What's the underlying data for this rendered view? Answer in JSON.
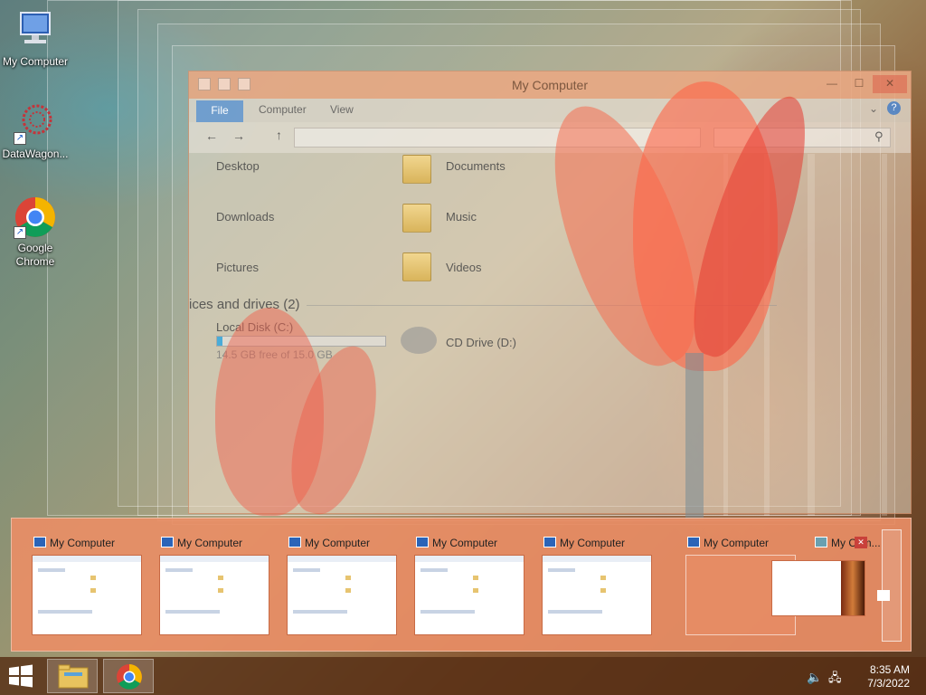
{
  "desktop": {
    "icons": [
      {
        "label": "My Computer"
      },
      {
        "label": "DataWagon..."
      },
      {
        "label": "Google Chrome"
      }
    ]
  },
  "explorer": {
    "title": "My Computer",
    "ribbon_tabs": [
      "File",
      "Computer",
      "View"
    ],
    "folders": [
      "Desktop",
      "Documents",
      "Downloads",
      "Music",
      "Pictures",
      "Videos"
    ],
    "devices_header": "ices and drives (2)",
    "drives": [
      {
        "name": "Local Disk (C:)",
        "free_text": "14.5 GB free of 15.0 GB",
        "used_fraction": 0.03
      },
      {
        "name": "CD Drive (D:)"
      }
    ]
  },
  "switcher": {
    "items": [
      {
        "title": "My Computer"
      },
      {
        "title": "My Computer"
      },
      {
        "title": "My Computer"
      },
      {
        "title": "My Computer"
      },
      {
        "title": "My Computer"
      },
      {
        "title": "My Computer"
      },
      {
        "title": "My Com..."
      }
    ],
    "close_glyph": "✕"
  },
  "taskbar": {
    "time": "8:35 AM",
    "date": "7/3/2022"
  },
  "colors": {
    "switcher_bg": "#e98e66",
    "taskbar_bg": "#552d14",
    "file_tab": "#3c82d2"
  }
}
